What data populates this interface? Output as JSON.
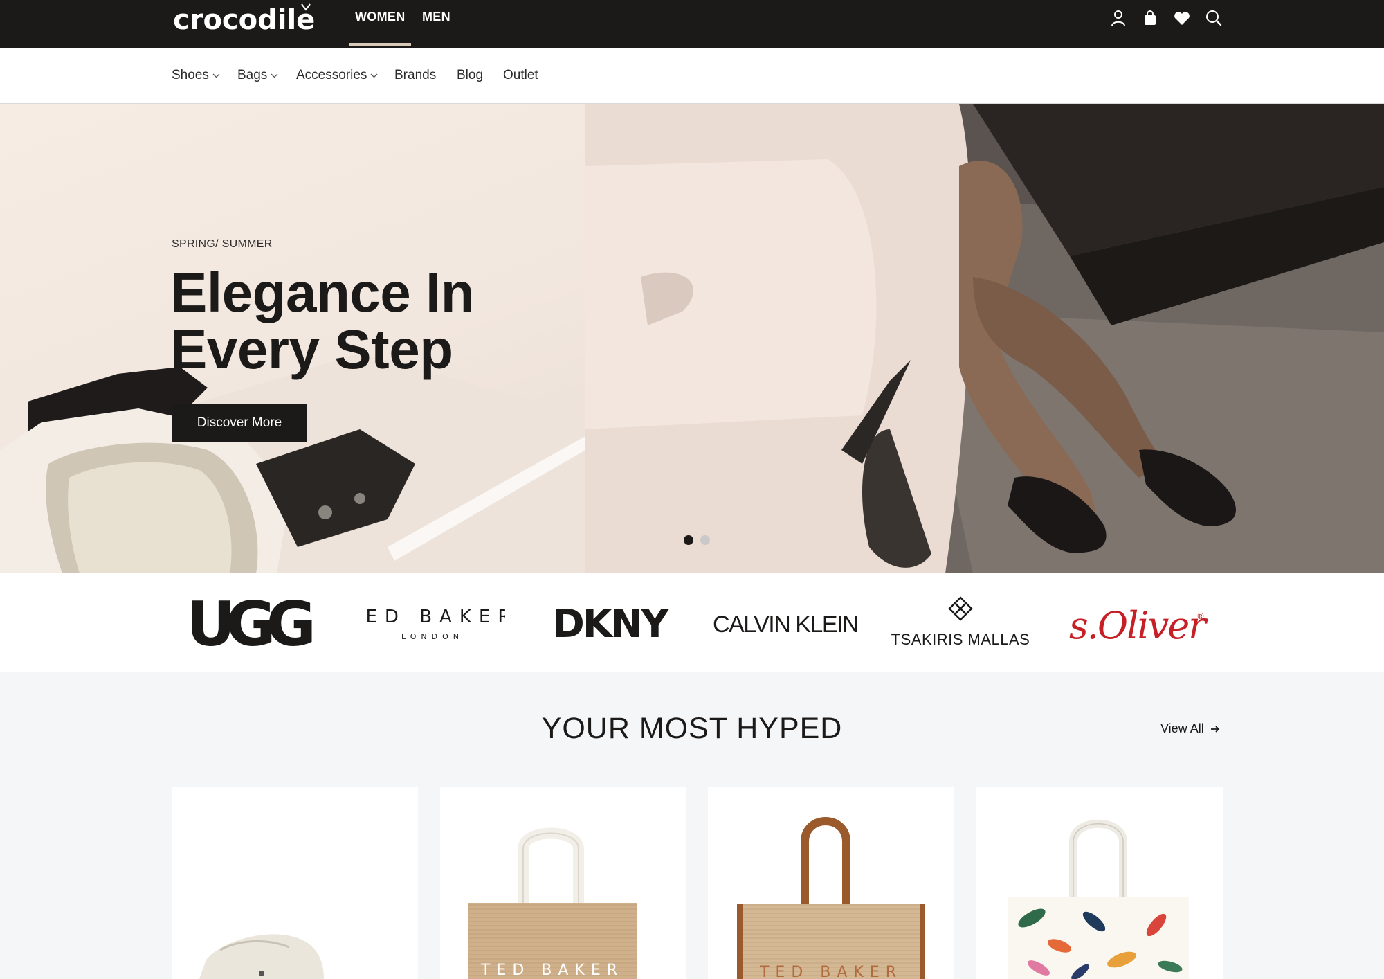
{
  "logo": {
    "text": "crocodile"
  },
  "top_nav": {
    "tabs": [
      {
        "label": "WOMEN",
        "active": true
      },
      {
        "label": "MEN",
        "active": false
      }
    ]
  },
  "top_icons": [
    "user-icon",
    "bag-icon",
    "heart-icon",
    "search-icon"
  ],
  "category_nav": [
    {
      "label": "Shoes",
      "dropdown": true
    },
    {
      "label": "Bags",
      "dropdown": true
    },
    {
      "label": "Accessories",
      "dropdown": true
    },
    {
      "label": "Brands",
      "dropdown": false
    },
    {
      "label": "Blog",
      "dropdown": false
    },
    {
      "label": "Outlet",
      "dropdown": false
    }
  ],
  "hero": {
    "kicker": "SPRING/ SUMMER",
    "title_line1": "Elegance In",
    "title_line2": "Every Step",
    "button": "Discover More",
    "slide_count": 2,
    "active_slide": 1
  },
  "brands": [
    {
      "name": "UGG",
      "logo": [
        "UGG"
      ]
    },
    {
      "name": "Ted Baker",
      "logo": [
        "TED BAKER",
        "LONDON"
      ]
    },
    {
      "name": "DKNY",
      "logo": [
        "DKNY"
      ]
    },
    {
      "name": "Calvin Klein",
      "logo": [
        "CALVIN KLEIN"
      ]
    },
    {
      "name": "Tsakiris Mallas",
      "logo": [
        "TSAKIRIS MALLAS"
      ]
    },
    {
      "name": "s.Oliver",
      "logo": [
        "s.Oliver",
        "®"
      ]
    }
  ],
  "most_hyped": {
    "title": "YOUR MOST HYPED",
    "view_all": "View All",
    "products": [
      {
        "name": "white-clog-shoe"
      },
      {
        "name": "ted-baker-tote-white-handles",
        "print": "TED BAKER"
      },
      {
        "name": "ted-baker-tote-brown-handles",
        "print": "TED BAKER"
      },
      {
        "name": "floral-tote-bag"
      }
    ]
  },
  "colors": {
    "dark": "#1c1a19",
    "accent_underline": "#d8c9b8",
    "soliver_red": "#c62026",
    "page_bg": "#f5f6f8"
  }
}
